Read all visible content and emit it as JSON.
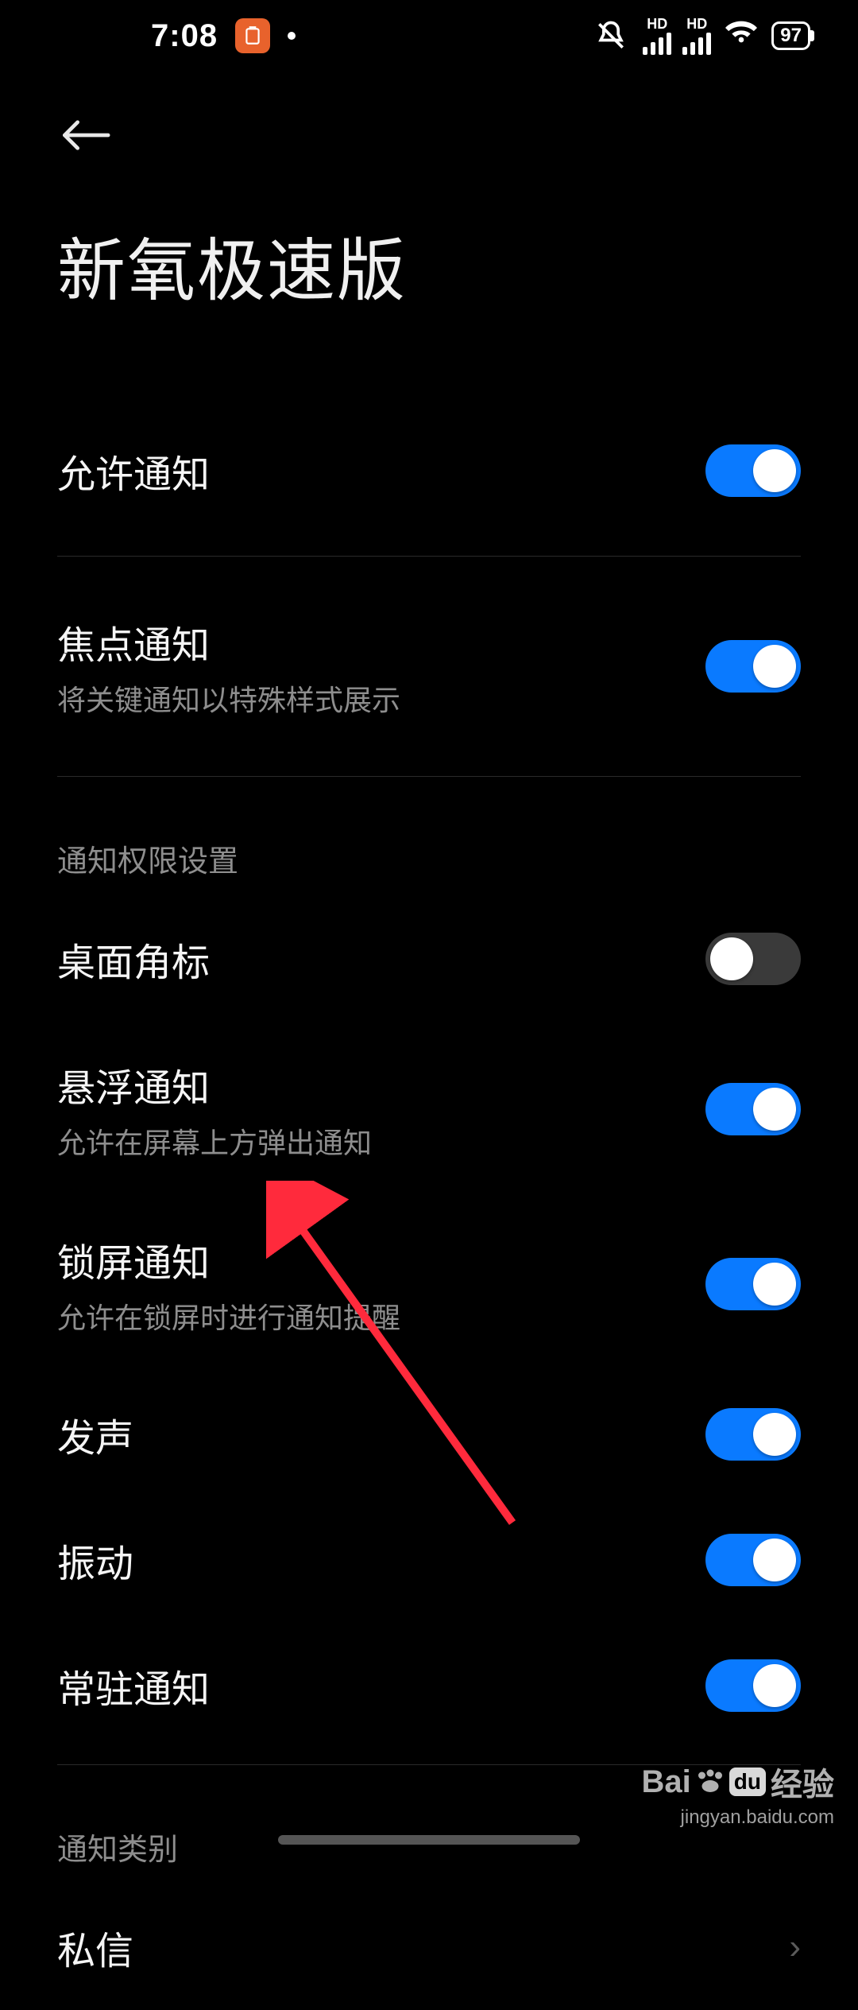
{
  "status": {
    "time": "7:08",
    "battery": "97",
    "signal1_label": "HD",
    "signal2_label": "HD"
  },
  "header": {
    "title": "新氧极速版"
  },
  "rows": {
    "allow": {
      "label": "允许通知",
      "on": true
    },
    "focus": {
      "label": "焦点通知",
      "sub": "将关键通知以特殊样式展示",
      "on": true
    }
  },
  "section_perm": "通知权限设置",
  "perm": {
    "badge": {
      "label": "桌面角标",
      "on": false
    },
    "float": {
      "label": "悬浮通知",
      "sub": "允许在屏幕上方弹出通知",
      "on": true
    },
    "lock": {
      "label": "锁屏通知",
      "sub": "允许在锁屏时进行通知提醒",
      "on": true
    },
    "sound": {
      "label": "发声",
      "on": true
    },
    "vibrate": {
      "label": "振动",
      "on": true
    },
    "persist": {
      "label": "常驻通知",
      "on": true
    }
  },
  "section_cat": "通知类别",
  "cat": {
    "dm": {
      "label": "私信"
    }
  },
  "watermark": {
    "brand_a": "Bai",
    "brand_b": "du",
    "brand_c": "经验",
    "url": "jingyan.baidu.com"
  },
  "colors": {
    "accent": "#0a7aff",
    "arrow": "#ff2a3c"
  }
}
